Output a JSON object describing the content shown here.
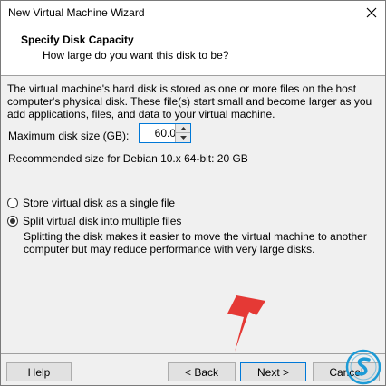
{
  "window": {
    "title": "New Virtual Machine Wizard"
  },
  "header": {
    "title": "Specify Disk Capacity",
    "subtitle": "How large do you want this disk to be?"
  },
  "description": "The virtual machine's hard disk is stored as one or more files on the host computer's physical disk. These file(s) start small and become larger as you add applications, files, and data to your virtual machine.",
  "disk_size": {
    "label": "Maximum disk size (GB):",
    "value": "60.0"
  },
  "recommended": "Recommended size for Debian 10.x 64-bit: 20 GB",
  "options": {
    "single": {
      "label": "Store virtual disk as a single file",
      "checked": false
    },
    "split": {
      "label": "Split virtual disk into multiple files",
      "checked": true
    },
    "split_description": "Splitting the disk makes it easier to move the virtual machine to another computer but may reduce performance with very large disks."
  },
  "buttons": {
    "help": "Help",
    "back": "< Back",
    "next": "Next >",
    "cancel": "Cancel"
  },
  "colors": {
    "focus_border": "#0078d7",
    "arrow": "#e53935",
    "logo": "#1d9bd6"
  },
  "icons": {
    "close": "close-icon",
    "spin_up": "chevron-up-icon",
    "spin_down": "chevron-down-icon",
    "annotation": "red-arrow-icon",
    "watermark": "solvetic-logo"
  }
}
